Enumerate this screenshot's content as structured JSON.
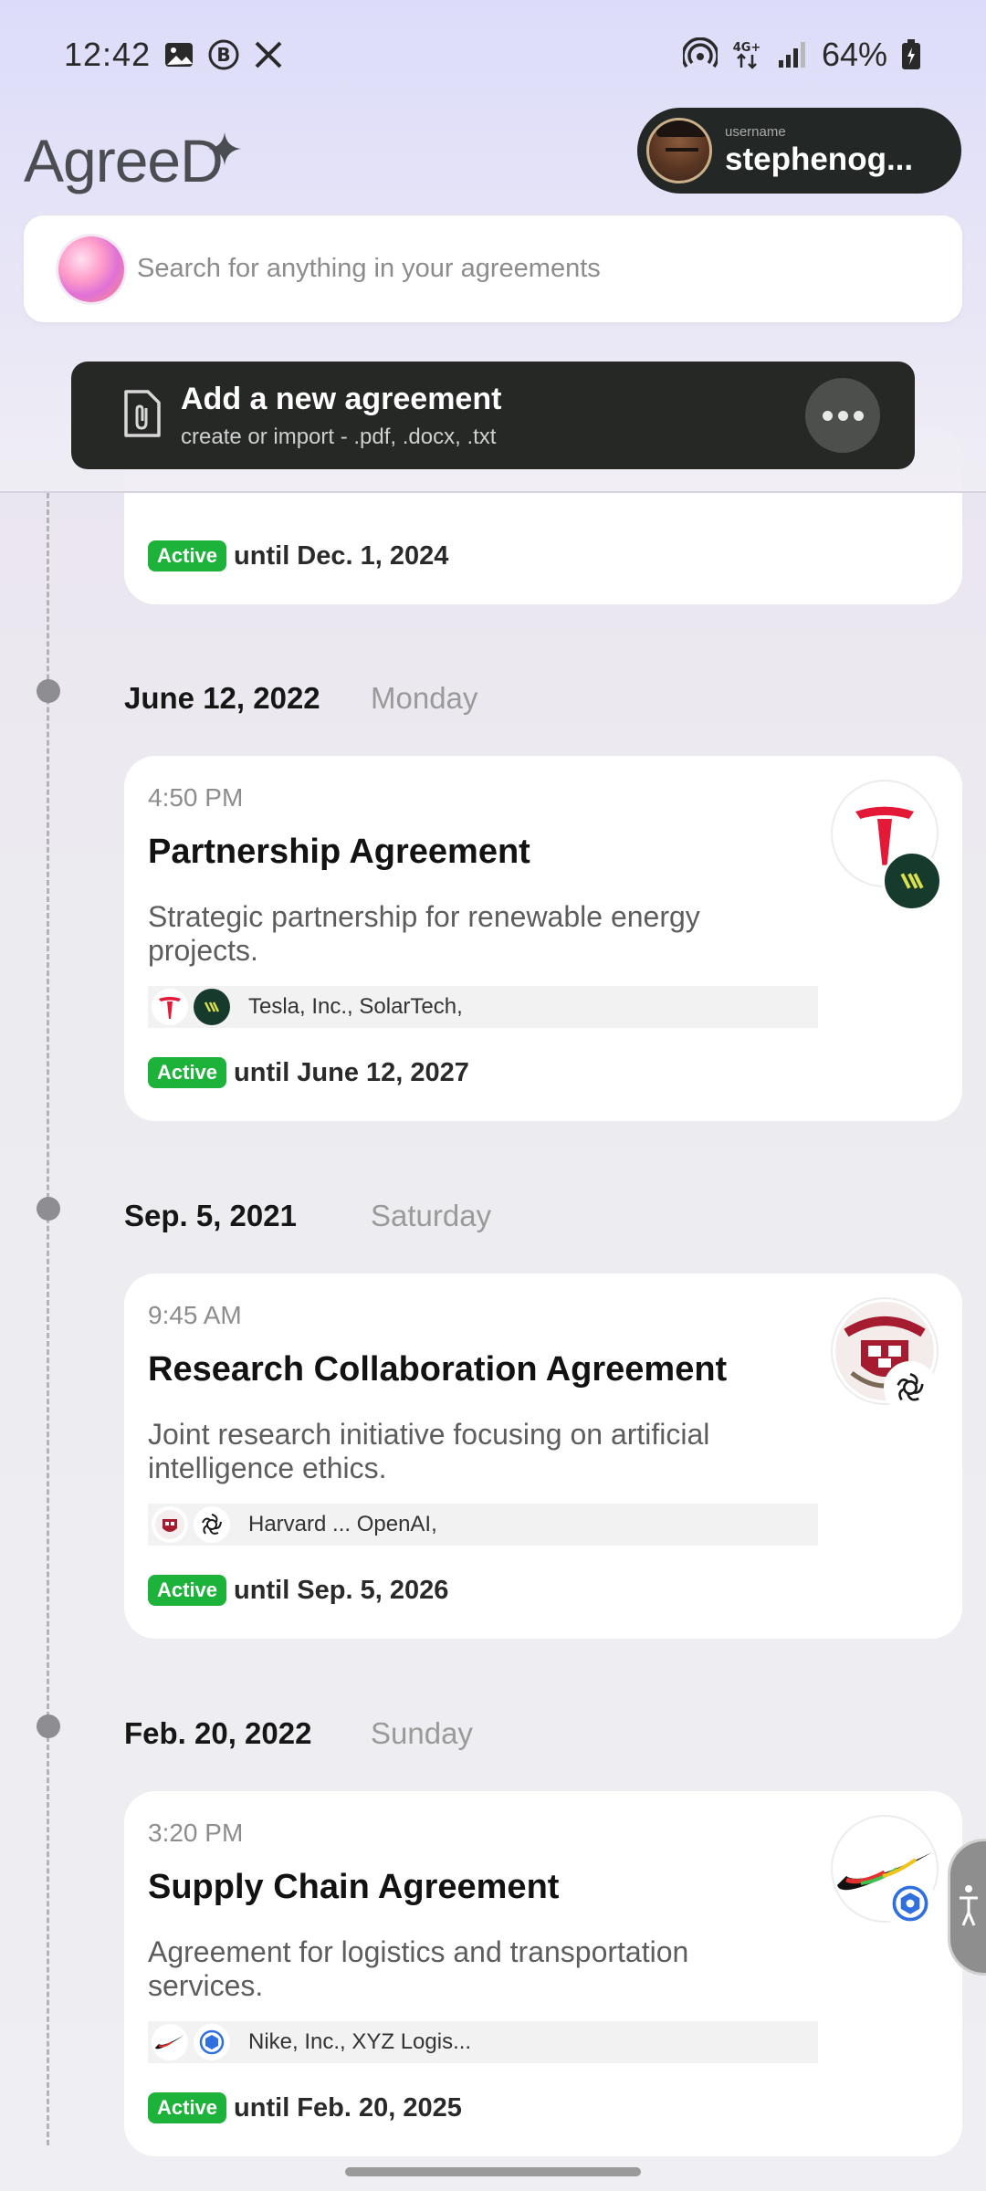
{
  "status_bar": {
    "time": "12:42",
    "battery": "64%",
    "network": "4G+"
  },
  "header": {
    "logo_text": "AgreeD",
    "user_caption": "username",
    "user_name": "stephenog...",
    "search_placeholder": "Search for anything in your agreements",
    "add_card": {
      "title": "Add a new agreement",
      "subtitle": "create or import - .pdf, .docx, .txt"
    }
  },
  "partial_card": {
    "badge": "Active",
    "until": "until Dec. 1, 2024"
  },
  "agreements": [
    {
      "date": "June 12, 2022",
      "weekday": "Monday",
      "time": "4:50 PM",
      "title": "Partnership Agreement",
      "description": "Strategic partnership for renewable energy projects.",
      "parties": "Tesla, Inc., SolarTech,",
      "badge": "Active",
      "until": "until June 12, 2027",
      "logos": [
        "tesla-logo",
        "solartech-logo"
      ]
    },
    {
      "date": "Sep. 5, 2021",
      "weekday": "Saturday",
      "time": "9:45 AM",
      "title": "Research Collaboration Agreement",
      "description": "Joint research initiative focusing on artificial intelligence ethics.",
      "parties": "Harvard ...  OpenAI,",
      "badge": "Active",
      "until": "until Sep. 5, 2026",
      "logos": [
        "harvard-logo",
        "openai-logo"
      ]
    },
    {
      "date": "Feb. 20, 2022",
      "weekday": "Sunday",
      "time": "3:20 PM",
      "title": "Supply Chain Agreement",
      "description": "Agreement for logistics and transportation services.",
      "parties": "Nike, Inc.,  XYZ Logis...",
      "badge": "Active",
      "until": "until Feb. 20, 2025",
      "logos": [
        "nike-logo",
        "xyz-logistics-logo"
      ]
    }
  ],
  "colors": {
    "active_badge": "#1db33b",
    "dark_card": "#252825",
    "accent_orb": "#ff9cc9"
  }
}
